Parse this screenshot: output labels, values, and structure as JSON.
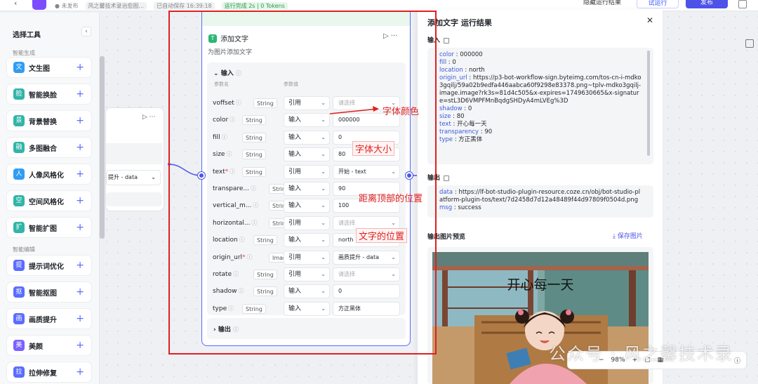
{
  "topbar": {
    "status_unpublished": "● 未发布",
    "author": "风之馨技术录治愈图...",
    "autosave": "已自动保存 16:39:18",
    "run_status": "运行完成 2s | 0 Tokens",
    "hide_results": "隐藏运行结果",
    "try_run": "试运行",
    "publish": "发布"
  },
  "sidebar": {
    "title": "选择工具",
    "section_generate": "智能生成",
    "section_edit": "智能编辑",
    "items": [
      {
        "label": "文生图",
        "color": "#2f9df4"
      },
      {
        "label": "智能换脸",
        "color": "#31b5a8"
      },
      {
        "label": "背景替换",
        "color": "#31b5a8"
      },
      {
        "label": "多图融合",
        "color": "#31b5a8"
      },
      {
        "label": "人像风格化",
        "color": "#2f9df4"
      },
      {
        "label": "空间风格化",
        "color": "#31b5a8"
      },
      {
        "label": "智能扩图",
        "color": "#31b5a8"
      },
      {
        "label": "提示词优化",
        "color": "#5b6cff"
      },
      {
        "label": "智能抠图",
        "color": "#5b6cff"
      },
      {
        "label": "画质提升",
        "color": "#5b6cff"
      },
      {
        "label": "美颜",
        "color": "#7b61ff"
      },
      {
        "label": "拉伸修复",
        "color": "#5b6cff"
      }
    ]
  },
  "left_node": {
    "select_value": "提升 - data"
  },
  "node": {
    "title": "添加文字",
    "description": "为图片添加文字",
    "input_label": "输入",
    "col_name": "参数名",
    "col_value": "参数值",
    "output_label": "输出",
    "params": [
      {
        "name": "voffset",
        "required": false,
        "type": "String",
        "source": "引用",
        "value": "请选择",
        "placeholder": true,
        "dropdown": true
      },
      {
        "name": "color",
        "required": false,
        "type": "String",
        "source": "输入",
        "value": "000000",
        "placeholder": false,
        "dropdown": false
      },
      {
        "name": "fill",
        "required": false,
        "type": "String",
        "source": "输入",
        "value": "0",
        "placeholder": false,
        "dropdown": false
      },
      {
        "name": "size",
        "required": false,
        "type": "String",
        "source": "输入",
        "value": "80",
        "placeholder": false,
        "dropdown": false
      },
      {
        "name": "text",
        "required": true,
        "type": "String",
        "source": "引用",
        "value": "开始 - text",
        "placeholder": false,
        "dropdown": true
      },
      {
        "name": "transpare...",
        "required": false,
        "type": "String",
        "source": "输入",
        "value": "90",
        "placeholder": false,
        "dropdown": false
      },
      {
        "name": "vertical_m...",
        "required": false,
        "type": "String",
        "source": "输入",
        "value": "100",
        "placeholder": false,
        "dropdown": false
      },
      {
        "name": "horizontal...",
        "required": false,
        "type": "String",
        "source": "引用",
        "value": "请选择",
        "placeholder": true,
        "dropdown": true
      },
      {
        "name": "location",
        "required": false,
        "type": "String",
        "source": "输入",
        "value": "north",
        "placeholder": false,
        "dropdown": false
      },
      {
        "name": "origin_url",
        "required": true,
        "type": "Image",
        "source": "引用",
        "value": "画质提升 - data",
        "placeholder": false,
        "dropdown": true
      },
      {
        "name": "rotate",
        "required": false,
        "type": "String",
        "source": "引用",
        "value": "请选择",
        "placeholder": true,
        "dropdown": true
      },
      {
        "name": "shadow",
        "required": false,
        "type": "String",
        "source": "输入",
        "value": "0",
        "placeholder": false,
        "dropdown": false
      },
      {
        "name": "type",
        "required": false,
        "type": "String",
        "source": "输入",
        "value": "方正黑体",
        "placeholder": false,
        "dropdown": false
      }
    ]
  },
  "annotations": {
    "font_color": "字体颜色",
    "font_size": "字体大小",
    "top_distance": "距离顶部的位置",
    "text_position": "文字的位置"
  },
  "panel": {
    "title": "添加文字 运行结果",
    "input_label": "输入",
    "output_label": "输出",
    "preview_label": "输出图片预览",
    "save_label": "保存图片",
    "input_lines": [
      {
        "key": "color",
        "value": "000000"
      },
      {
        "key": "fill",
        "value": "0"
      },
      {
        "key": "location",
        "value": "north"
      },
      {
        "key": "origin_url",
        "value": "https://p3-bot-workflow-sign.byteimg.com/tos-cn-i-mdko3gqilj/59a02b9edfa446aabca60f9298e83378.png~tplv-mdko3gqilj-image.image?rk3s=81d4c505&x-expires=1749630665&x-signature=stL3D6VMPFMnBqdgSHDyA4mLVEg%3D"
      },
      {
        "key": "shadow",
        "value": "0"
      },
      {
        "key": "size",
        "value": "80"
      },
      {
        "key": "text",
        "value": "开心每一天"
      },
      {
        "key": "transparency",
        "value": "90"
      },
      {
        "key": "type",
        "value": "方正黑体"
      }
    ],
    "output_lines": [
      {
        "key": "data",
        "value": "https://lf-bot-studio-plugin-resource.coze.cn/obj/bot-studio-platform-plugin-tos/text/7d2458d7d12a48489f44d97809f0504d.png"
      },
      {
        "key": "msg",
        "value": "success"
      }
    ],
    "image_text": "开心每一天"
  },
  "toolbar": {
    "zoom": "98%",
    "minus": "−",
    "plus": "+"
  },
  "watermark": "公众号 · 风之馨技术录",
  "colors": {
    "accent": "#4d53e8",
    "annotation_red": "#e02020",
    "node_icon": "#2bb673"
  }
}
